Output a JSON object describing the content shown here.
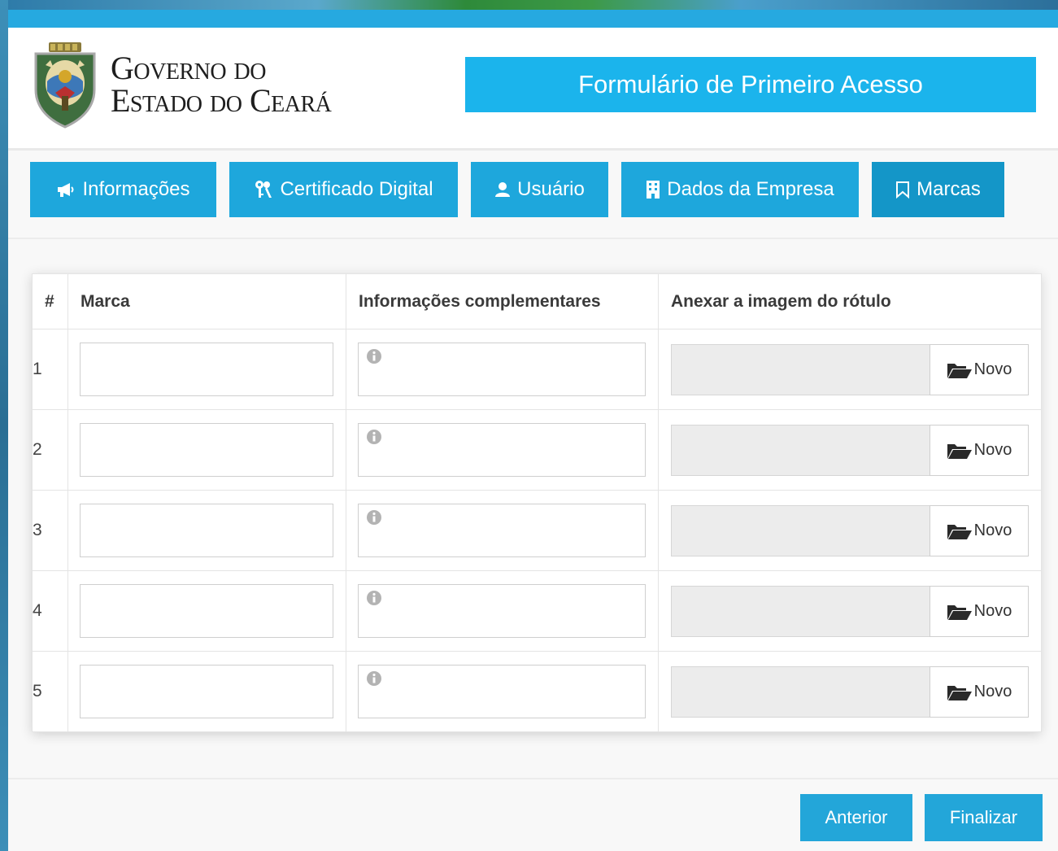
{
  "header": {
    "gov_line1": "Governo do",
    "gov_line2": "Estado do Ceará",
    "form_title": "Formulário de Primeiro Acesso"
  },
  "tabs": [
    {
      "label": "Informações",
      "icon": "megaphone-icon"
    },
    {
      "label": "Certificado Digital",
      "icon": "keys-icon"
    },
    {
      "label": "Usuário",
      "icon": "user-icon"
    },
    {
      "label": "Dados da Empresa",
      "icon": "building-icon"
    },
    {
      "label": "Marcas",
      "icon": "bookmark-icon",
      "active": true
    }
  ],
  "table": {
    "headers": [
      "#",
      "Marca",
      "Informações complementares",
      "Anexar a imagem do rótulo"
    ],
    "rows": [
      {
        "num": "1",
        "marca": "",
        "info": "",
        "file": ""
      },
      {
        "num": "2",
        "marca": "",
        "info": "",
        "file": ""
      },
      {
        "num": "3",
        "marca": "",
        "info": "",
        "file": ""
      },
      {
        "num": "4",
        "marca": "",
        "info": "",
        "file": ""
      },
      {
        "num": "5",
        "marca": "",
        "info": "",
        "file": ""
      }
    ],
    "novo_label": "Novo"
  },
  "footer": {
    "prev_label": "Anterior",
    "finish_label": "Finalizar"
  },
  "colors": {
    "accent": "#1ea7dc",
    "active_tab": "#1496c8",
    "title_bg": "#1bb4ec"
  }
}
